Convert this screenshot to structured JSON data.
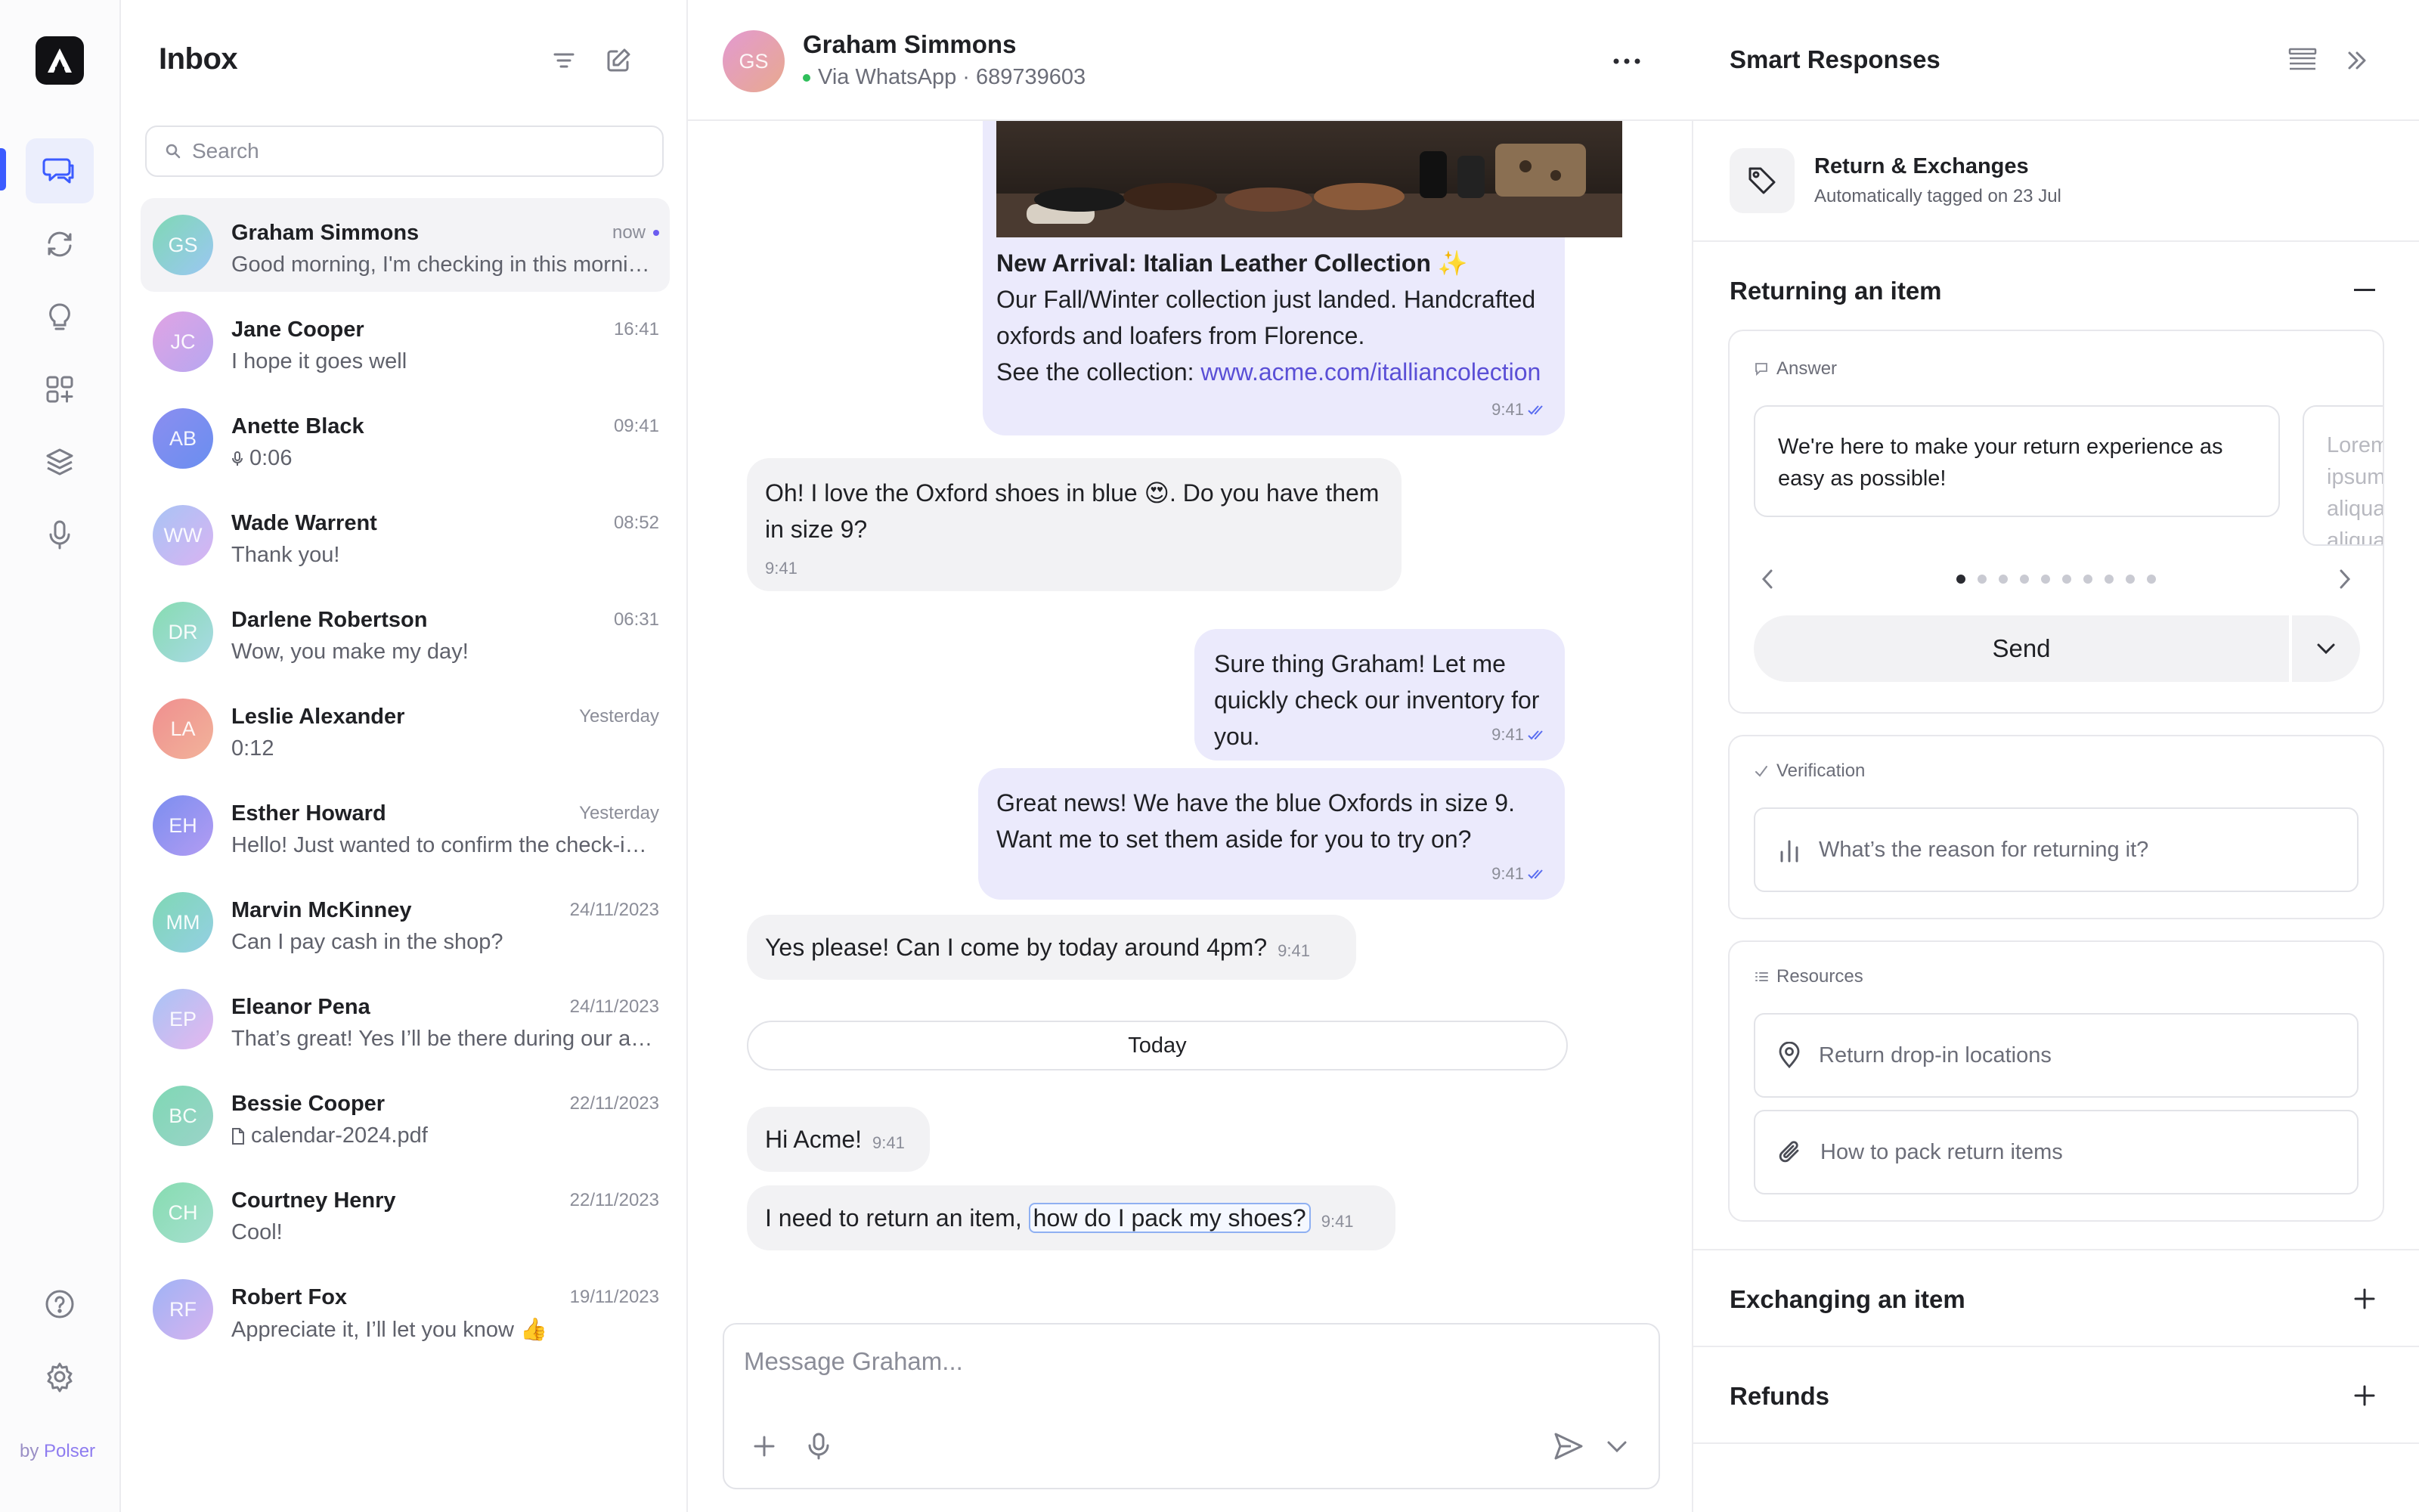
{
  "brand": {
    "footer_prefix": "by ",
    "footer_brand": "Polser"
  },
  "rail": {
    "items": [
      {
        "icon": "chat-bubbles-icon",
        "active": true
      },
      {
        "icon": "sync-icon"
      },
      {
        "icon": "lightbulb-icon"
      },
      {
        "icon": "apps-icon"
      },
      {
        "icon": "layers-icon"
      },
      {
        "icon": "microphone-icon"
      }
    ],
    "bottom": [
      {
        "icon": "help-icon"
      },
      {
        "icon": "settings-icon"
      }
    ]
  },
  "inbox": {
    "title": "Inbox",
    "search_placeholder": "Search",
    "conversations": [
      {
        "initials": "GS",
        "name": "Graham Simmons",
        "time": "now",
        "preview": "Good morning, I'm checking in this morning about my order",
        "unread": true,
        "active": true,
        "color_from": "#7fd8b4",
        "color_to": "#9bc7f3"
      },
      {
        "initials": "JC",
        "name": "Jane Cooper",
        "time": "16:41",
        "preview": "I hope it goes well",
        "color_from": "#e0a4e4",
        "color_to": "#b7a6f0"
      },
      {
        "initials": "AB",
        "name": "Anette Black",
        "time": "09:41",
        "preview": "0:06",
        "preview_icon": "voice-note-icon",
        "color_from": "#8b8df0",
        "color_to": "#6a8ff0"
      },
      {
        "initials": "WW",
        "name": "Wade Warrent",
        "time": "08:52",
        "preview": "Thank you!",
        "color_from": "#a8c4f5",
        "color_to": "#d9b3f2"
      },
      {
        "initials": "DR",
        "name": "Darlene Robertson",
        "time": "06:31",
        "preview": "Wow, you make my day!",
        "color_from": "#86dcb0",
        "color_to": "#a9d9e6"
      },
      {
        "initials": "LA",
        "name": "Leslie Alexander",
        "time": "Yesterday",
        "preview": "0:12",
        "color_from": "#ef8f8f",
        "color_to": "#f2b39a"
      },
      {
        "initials": "EH",
        "name": "Esther Howard",
        "time": "Yesterday",
        "preview": "Hello! Just wanted to confirm the check-in time",
        "color_from": "#7b8ef0",
        "color_to": "#b39cf2"
      },
      {
        "initials": "MM",
        "name": "Marvin McKinney",
        "time": "24/11/2023",
        "preview": "Can I pay cash in the shop?",
        "color_from": "#7fd8b4",
        "color_to": "#94cfe4"
      },
      {
        "initials": "EP",
        "name": "Eleanor Pena",
        "time": "24/11/2023",
        "preview": "That’s great! Yes I’ll be there during our appointment",
        "color_from": "#a8c4f5",
        "color_to": "#e6b6ee"
      },
      {
        "initials": "BC",
        "name": "Bessie Cooper",
        "time": "22/11/2023",
        "preview": "calendar-2024.pdf",
        "preview_icon": "file-icon",
        "color_from": "#7fd8b4",
        "color_to": "#9bd3c9"
      },
      {
        "initials": "CH",
        "name": "Courtney Henry",
        "time": "22/11/2023",
        "preview": "Cool!",
        "color_from": "#86dcb0",
        "color_to": "#a6dfd0"
      },
      {
        "initials": "RF",
        "name": "Robert Fox",
        "time": "19/11/2023",
        "preview": "Appreciate it, I’ll let you know 👍",
        "color_from": "#9fb3f5",
        "color_to": "#d8b3ef"
      }
    ]
  },
  "chat": {
    "contact_initials": "GS",
    "contact_name": "Graham Simmons",
    "channel": "Via WhatsApp · 689739603",
    "promo": {
      "title": "New Arrival: Italian Leather Collection ✨",
      "body": "Our Fall/Winter collection just landed. Handcrafted oxfords and loafers from Florence.",
      "link_prefix": "See the collection: ",
      "link": "www.acme.com/italliancolection",
      "time": "9:41"
    },
    "messages": [
      {
        "dir": "in",
        "text": "Oh! I love the Oxford shoes in blue 😍. Do you have them in size 9?",
        "time": "9:41"
      },
      {
        "dir": "out",
        "text": "Sure thing Graham! Let me quickly check our inventory for you.",
        "time": "9:41"
      },
      {
        "dir": "out",
        "text": "Great news! We have the blue Oxfords in size 9. Want me to set them aside for you to try on?",
        "time": "9:41"
      },
      {
        "dir": "in",
        "text": "Yes please! Can I come by today around 4pm?",
        "time": "9:41"
      },
      {
        "dir": "in",
        "text": "Hi Acme!",
        "time": "9:41"
      },
      {
        "dir": "in",
        "text_prefix": "I need to return an item, ",
        "text_highlight": "how do I pack my shoes?",
        "time": "9:41"
      }
    ],
    "divider": "Today",
    "composer_placeholder": "Message Graham..."
  },
  "smart": {
    "title": "Smart Responses",
    "tag": {
      "title": "Return & Exchanges",
      "subtitle": "Automatically tagged on 23 Jul"
    },
    "section_open": "Returning an item",
    "answer_label": "Answer",
    "answer_text": "We're here to make your return experience as easy as possible!",
    "answer_peek": "Lorem ipsum aliqua aliqua",
    "dots_total": 10,
    "dots_active": 1,
    "send_label": "Send",
    "verification_label": "Verification",
    "verification_question": "What’s the reason for returning it?",
    "resources_label": "Resources",
    "resources": [
      {
        "label": "Return drop-in locations",
        "icon": "location-pin-icon"
      },
      {
        "label": "How to pack return items",
        "icon": "paperclip-icon"
      }
    ],
    "collapsed_sections": [
      "Exchanging an item",
      "Refunds"
    ]
  },
  "colors": {
    "accent": "#3b5bff",
    "bubble_out": "#ebeafc",
    "bubble_in": "#f2f2f4",
    "link": "#5a4fd6"
  }
}
